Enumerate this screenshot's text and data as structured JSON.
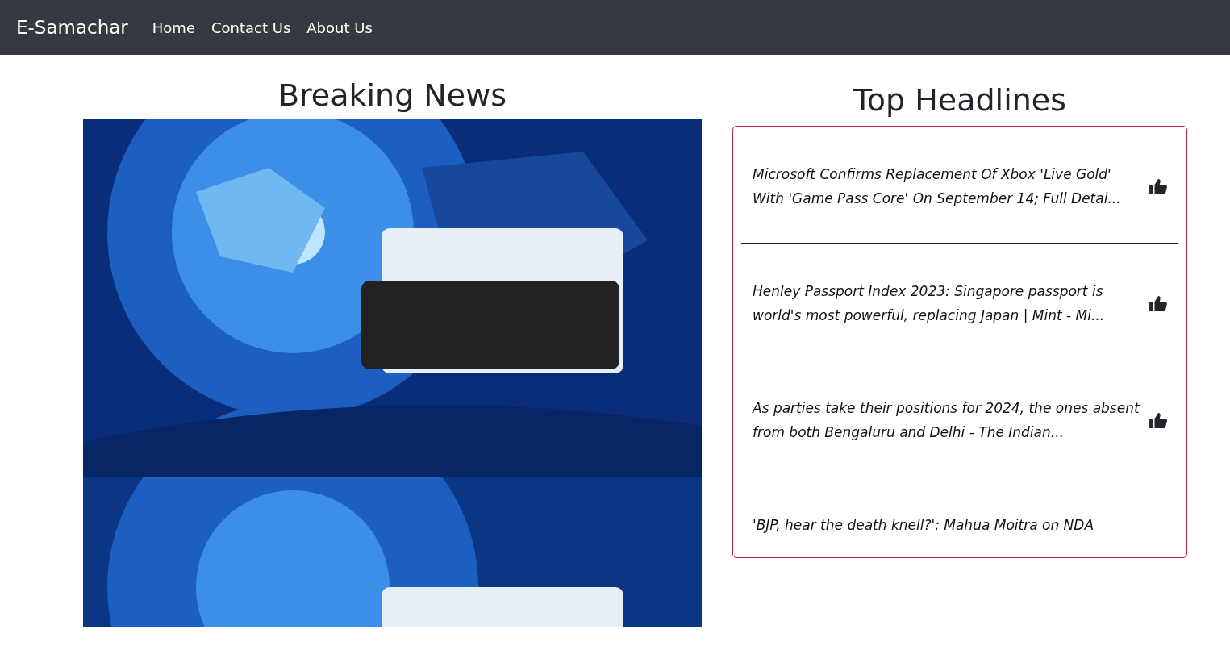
{
  "navbar": {
    "brand": "E-Samachar",
    "links": [
      {
        "label": "Home"
      },
      {
        "label": "Contact Us"
      },
      {
        "label": "About Us"
      }
    ]
  },
  "breaking": {
    "title": "Breaking News"
  },
  "headlines": {
    "title": "Top Headlines",
    "items": [
      {
        "text": "Microsoft Confirms Replacement Of Xbox 'Live Gold' With 'Game Pass Core' On September 14; Full Detai..."
      },
      {
        "text": "Henley Passport Index 2023: Singapore passport is world's most powerful, replacing Japan | Mint - Mi..."
      },
      {
        "text": "As parties take their positions for 2024, the ones absent from both Bengaluru and Delhi - The Indian..."
      },
      {
        "text": "'BJP, hear the death knell?': Mahua Moitra on NDA"
      }
    ]
  }
}
